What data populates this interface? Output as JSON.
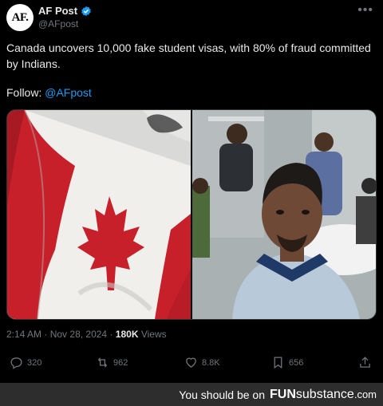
{
  "account": {
    "avatar_text": "AF.",
    "name": "AF Post",
    "handle": "@AFpost"
  },
  "post": {
    "text": "Canada uncovers 10,000 fake student visas, with 80% of fraud committed by Indians.",
    "follow_label": "Follow:",
    "follow_link": "@AFpost",
    "time": "2:14 AM",
    "separator": "·",
    "date": "Nov 28, 2024",
    "views_count": "180K",
    "views_label": "Views"
  },
  "actions": {
    "replies": "320",
    "reposts": "962",
    "likes": "8.8K",
    "bookmarks": "656"
  },
  "icons": [
    "verified-badge-icon",
    "more-icon",
    "reply-icon",
    "repost-icon",
    "like-icon",
    "bookmark-icon",
    "share-icon"
  ],
  "colors": {
    "accent": "#1d9bf0",
    "muted": "#71767b",
    "text": "#e7e9ea",
    "flag_red": "#c8202b"
  },
  "footer": {
    "prefix": "You should be on",
    "brand_bold": "FUN",
    "brand_rest": "substance",
    "domain": ".com"
  }
}
